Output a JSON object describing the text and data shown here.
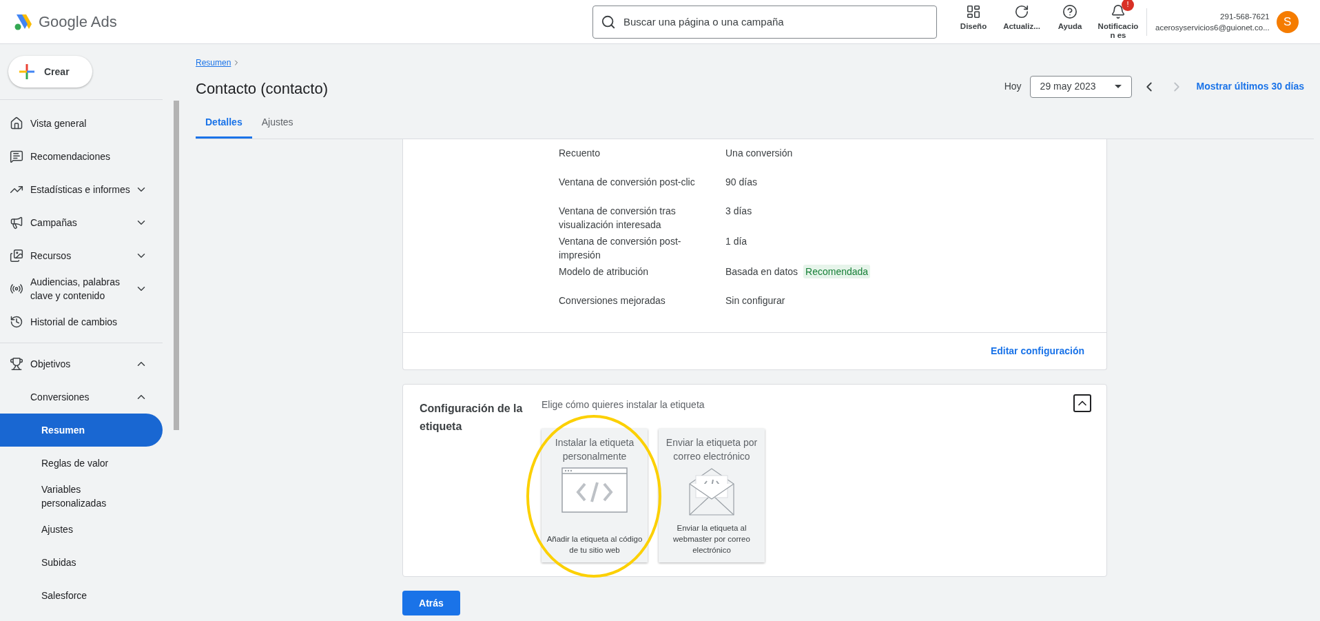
{
  "app": {
    "name": "Google Ads"
  },
  "search": {
    "placeholder": "Buscar una página o una campaña"
  },
  "toolbar": [
    {
      "label": "Diseño"
    },
    {
      "label": "Actualiz..."
    },
    {
      "label": "Ayuda"
    },
    {
      "label": "Notificacion es",
      "badge": "!"
    }
  ],
  "account": {
    "phone": "291-568-7621",
    "email": "acerosyservicios6@guionet.co...",
    "avatar": "S"
  },
  "create_button": "Crear",
  "sidebar": {
    "items": [
      {
        "label": "Vista general",
        "selected": false
      },
      {
        "label": "Recomendaciones",
        "selected": false
      },
      {
        "label": "Estadísticas e informes",
        "selected": false,
        "expanded": false
      },
      {
        "label": "Campañas",
        "selected": false,
        "expanded": false
      },
      {
        "label": "Recursos",
        "selected": false,
        "expanded": false
      },
      {
        "label": "Audiencias, palabras clave y contenido",
        "selected": false,
        "expanded": false
      },
      {
        "label": "Historial de cambios",
        "selected": false
      },
      {
        "label": "Objetivos",
        "selected": false,
        "expanded": true,
        "children": [
          {
            "label": "Conversiones",
            "selected": false,
            "expanded": true,
            "children": [
              {
                "label": "Resumen",
                "selected": true
              },
              {
                "label": "Reglas de valor",
                "selected": false
              },
              {
                "label": "Variables personalizadas",
                "selected": false
              },
              {
                "label": "Ajustes",
                "selected": false
              },
              {
                "label": "Subidas",
                "selected": false
              },
              {
                "label": "Salesforce",
                "selected": false
              }
            ]
          }
        ]
      }
    ]
  },
  "breadcrumb": "Resumen",
  "page_title": "Contacto (contacto)",
  "date": {
    "label": "Hoy",
    "value": "29 may 2023",
    "range_link": "Mostrar últimos 30 días",
    "next_disabled": true
  },
  "tabs": [
    {
      "label": "Detalles",
      "selected": true
    },
    {
      "label": "Ajustes",
      "selected": false
    }
  ],
  "settings": {
    "rows": [
      {
        "label": "Recuento",
        "value": "Una conversión"
      },
      {
        "label": "Ventana de conversión post-clic",
        "value": "90 días"
      },
      {
        "label": "Ventana de conversión tras visualización interesada",
        "value": "3 días"
      },
      {
        "label": "Ventana de conversión post-impresión",
        "value": "1 día"
      },
      {
        "label": "Modelo de atribución",
        "value": "Basada en datos",
        "badge": "Recomendada"
      },
      {
        "label": "Conversiones mejoradas",
        "value": "Sin configurar"
      }
    ],
    "edit_link": "Editar configuración"
  },
  "tag_setup": {
    "title": "Configuración de la etiqueta",
    "prompt": "Elige cómo quieres instalar la etiqueta",
    "expanded": true,
    "options": [
      {
        "kind": "code",
        "title": "Instalar la etiqueta personalmente",
        "description": "Añadir la etiqueta al código de tu sitio web",
        "highlighted": true
      },
      {
        "kind": "email",
        "title": "Enviar la etiqueta por correo electrónico",
        "description": "Enviar la etiqueta al webmaster por correo electrónico",
        "highlighted": false
      }
    ]
  },
  "back_button": "Atrás"
}
